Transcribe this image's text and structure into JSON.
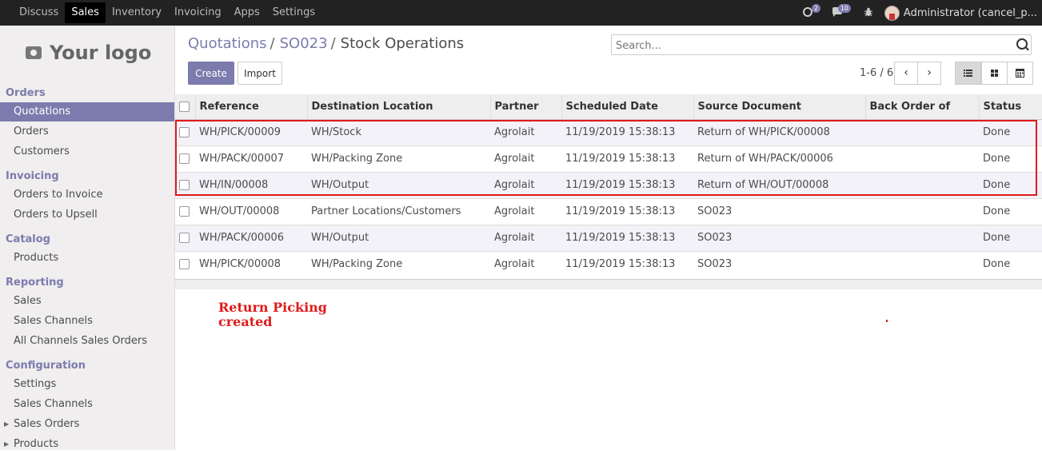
{
  "topbar": {
    "menu": [
      "Discuss",
      "Sales",
      "Inventory",
      "Invoicing",
      "Apps",
      "Settings"
    ],
    "active_menu": "Sales",
    "activity_badge": "2",
    "messages_badge": "10",
    "user_name": "Administrator (cancel_p..."
  },
  "sidebar": {
    "logo_text": "Your logo",
    "sections": [
      {
        "title": "Orders",
        "items": [
          "Quotations",
          "Orders",
          "Customers"
        ]
      },
      {
        "title": "Invoicing",
        "items": [
          "Orders to Invoice",
          "Orders to Upsell"
        ]
      },
      {
        "title": "Catalog",
        "items": [
          "Products"
        ]
      },
      {
        "title": "Reporting",
        "items": [
          "Sales",
          "Sales Channels",
          "All Channels Sales Orders"
        ]
      },
      {
        "title": "Configuration",
        "items": [
          "Settings",
          "Sales Channels",
          "Sales Orders",
          "Products"
        ]
      }
    ],
    "active_item": "Quotations"
  },
  "breadcrumb": {
    "crumb1": "Quotations",
    "sep1": "/",
    "crumb2": "SO023",
    "sep2": "/",
    "current": "Stock Operations"
  },
  "search": {
    "placeholder": "Search..."
  },
  "buttons": {
    "create": "Create",
    "import": "Import"
  },
  "pager": {
    "value": "1-6 / 6"
  },
  "table": {
    "columns": [
      "Reference",
      "Destination Location",
      "Partner",
      "Scheduled Date",
      "Source Document",
      "Back Order of",
      "Status"
    ],
    "rows": [
      [
        "WH/PICK/00009",
        "WH/Stock",
        "Agrolait",
        "11/19/2019 15:38:13",
        "Return of WH/PICK/00008",
        "",
        "Done"
      ],
      [
        "WH/PACK/00007",
        "WH/Packing Zone",
        "Agrolait",
        "11/19/2019 15:38:13",
        "Return of WH/PACK/00006",
        "",
        "Done"
      ],
      [
        "WH/IN/00008",
        "WH/Output",
        "Agrolait",
        "11/19/2019 15:38:13",
        "Return of WH/OUT/00008",
        "",
        "Done"
      ],
      [
        "WH/OUT/00008",
        "Partner Locations/Customers",
        "Agrolait",
        "11/19/2019 15:38:13",
        "SO023",
        "",
        "Done"
      ],
      [
        "WH/PACK/00006",
        "WH/Output",
        "Agrolait",
        "11/19/2019 15:38:13",
        "SO023",
        "",
        "Done"
      ],
      [
        "WH/PICK/00008",
        "WH/Packing Zone",
        "Agrolait",
        "11/19/2019 15:38:13",
        "SO023",
        "",
        "Done"
      ]
    ]
  },
  "annotation": {
    "line1": "Return Picking",
    "line2": "created",
    "color": "#e01b1b"
  },
  "colors": {
    "brand": "#7c7bad",
    "topbar": "#222222"
  }
}
